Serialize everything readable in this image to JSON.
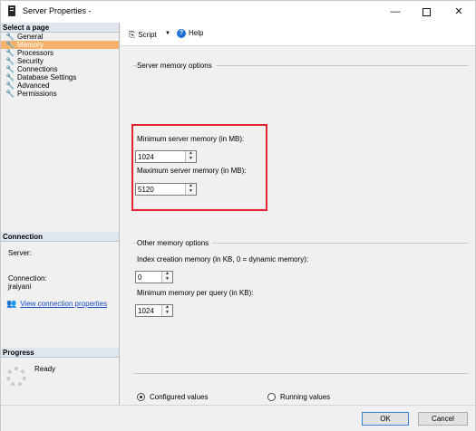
{
  "window": {
    "title": "Server Properties -"
  },
  "left": {
    "select_page_title": "Select a page",
    "pages": [
      {
        "label": "General"
      },
      {
        "label": "Memory"
      },
      {
        "label": "Processors"
      },
      {
        "label": "Security"
      },
      {
        "label": "Connections"
      },
      {
        "label": "Database Settings"
      },
      {
        "label": "Advanced"
      },
      {
        "label": "Permissions"
      }
    ],
    "selected_page": "Memory",
    "connection_title": "Connection",
    "server_label": "Server:",
    "connection_label": "Connection:",
    "connection_user": "jraiyani",
    "view_connection_link": "View connection properties",
    "progress_title": "Progress",
    "progress_status": "Ready"
  },
  "toolbar": {
    "script_label": "Script",
    "help_label": "Help"
  },
  "server_memory": {
    "group_label": "Server memory options",
    "min_label": "Minimum server memory (in MB):",
    "min_value": "1024",
    "max_label": "Maximum server memory (in MB):",
    "max_value": "5120"
  },
  "other_memory": {
    "group_label": "Other memory options",
    "index_label": "Index creation memory (in KB, 0 = dynamic memory):",
    "index_value": "0",
    "min_query_label": "Minimum memory per query (in KB):",
    "min_query_value": "1024"
  },
  "values_mode": {
    "configured_label": "Configured values",
    "running_label": "Running values",
    "selected": "Configured values"
  },
  "buttons": {
    "ok": "OK",
    "cancel": "Cancel"
  },
  "colors": {
    "selected_page_bg": "#f6b26b",
    "highlight_border": "#e0242e",
    "link": "#1a48c4"
  }
}
